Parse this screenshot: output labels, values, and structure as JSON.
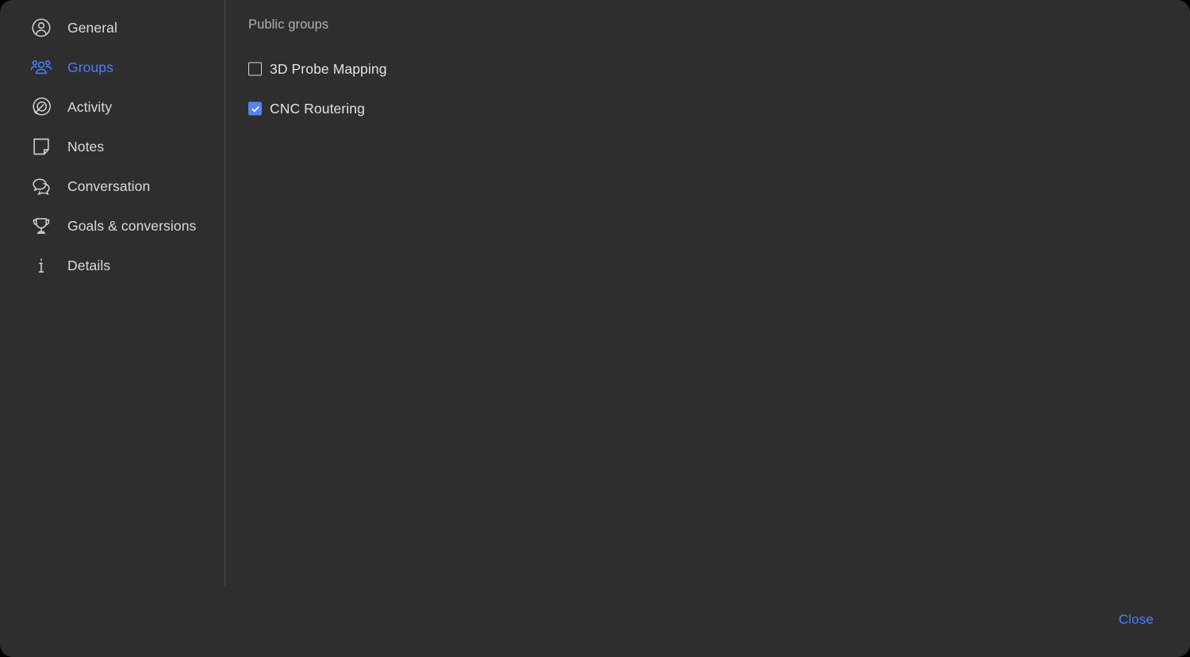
{
  "theme": {
    "panel_bg": "#2e2e2e",
    "backdrop": "#000000",
    "accent": "#4a7dfc",
    "checkbox_checked": "#5585f0",
    "text_primary": "#dcdcdc",
    "text_muted": "#b2b2b2",
    "divider": "#4e4e4e"
  },
  "sidebar": {
    "items": [
      {
        "label": "General",
        "icon": "person-circle-icon",
        "active": false
      },
      {
        "label": "Groups",
        "icon": "people-group-icon",
        "active": true
      },
      {
        "label": "Activity",
        "icon": "target-arrow-icon",
        "active": false
      },
      {
        "label": "Notes",
        "icon": "note-page-icon",
        "active": false
      },
      {
        "label": "Conversation",
        "icon": "chat-bubbles-icon",
        "active": false
      },
      {
        "label": "Goals & conversions",
        "icon": "trophy-icon",
        "active": false
      },
      {
        "label": "Details",
        "icon": "info-i-icon",
        "active": false
      }
    ]
  },
  "main": {
    "title": "Public groups",
    "groups": [
      {
        "label": "3D Probe Mapping",
        "checked": false
      },
      {
        "label": "CNC Routering",
        "checked": true
      }
    ]
  },
  "footer": {
    "close_label": "Close"
  }
}
